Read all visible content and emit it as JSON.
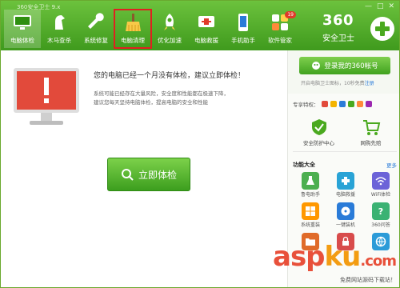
{
  "window": {
    "title": "360安全卫士 9.x",
    "controls": [
      "—",
      "□",
      "✕"
    ]
  },
  "toolbar": {
    "items": [
      {
        "label": "电脑体检",
        "icon": "monitor-icon",
        "state": "active"
      },
      {
        "label": "木马查杀",
        "icon": "horse-icon",
        "state": ""
      },
      {
        "label": "系统修复",
        "icon": "wrench-icon",
        "state": ""
      },
      {
        "label": "电脑清理",
        "icon": "broom-icon",
        "state": "highlight"
      },
      {
        "label": "优化加速",
        "icon": "rocket-icon",
        "state": ""
      },
      {
        "label": "电脑救援",
        "icon": "rescue-icon",
        "state": ""
      },
      {
        "label": "手机助手",
        "icon": "phone-icon",
        "state": ""
      },
      {
        "label": "软件管家",
        "icon": "apps-icon",
        "badge": "19"
      }
    ]
  },
  "logo": {
    "number": "360",
    "name": "安全卫士"
  },
  "main": {
    "message": "您的电脑已经一个月没有体检，建议立即体检！",
    "hint_line1": "系统可能已经存在大量风险，安全度和性能都在极速下降，",
    "hint_line2": "建议您每天坚持电脑体检，提高电脑的安全和性能",
    "button_label": "立即体检"
  },
  "sidebar": {
    "login_label": "登录我的360帐号",
    "login_sub_prefix": "开启",
    "login_sub_mid": "电脑卫士图标，10秒免费",
    "login_sub_reg": "注册",
    "vip_label": "专享特权：",
    "quick": [
      {
        "label": "安全防护中心",
        "icon": "shield-check-icon"
      },
      {
        "label": "网购先赔",
        "icon": "cart-icon"
      }
    ],
    "func_title": "功能大全",
    "func_more": "更多",
    "grid": [
      {
        "label": "鲁电助手",
        "icon": "flask-icon",
        "color": "#4caf50"
      },
      {
        "label": "电脑救援",
        "icon": "rescue-icon",
        "color": "#29a3d6"
      },
      {
        "label": "WiFi体检",
        "icon": "wifi-icon",
        "color": "#6c63d8"
      },
      {
        "label": "系统重装",
        "icon": "windows-icon",
        "color": "#ff9800"
      },
      {
        "label": "一键装机",
        "icon": "disk-icon",
        "color": "#2a7bd8"
      },
      {
        "label": "360问答",
        "icon": "question-icon",
        "color": "#3bb273"
      },
      {
        "label": "",
        "icon": "folder-icon",
        "color": "#e06b2a"
      },
      {
        "label": "",
        "icon": "lock-icon",
        "color": "#d84c4c"
      },
      {
        "label": "",
        "icon": "browser-icon",
        "color": "#2c9bd8"
      }
    ]
  },
  "watermark": {
    "asp": "asp",
    "ku": "ku",
    "dotcom": ".com",
    "small": "免费网站源码下载站！"
  },
  "colors": {
    "brand_green": "#4aa91f",
    "alert_red": "#e03a2a",
    "button_green": "#48a624"
  }
}
